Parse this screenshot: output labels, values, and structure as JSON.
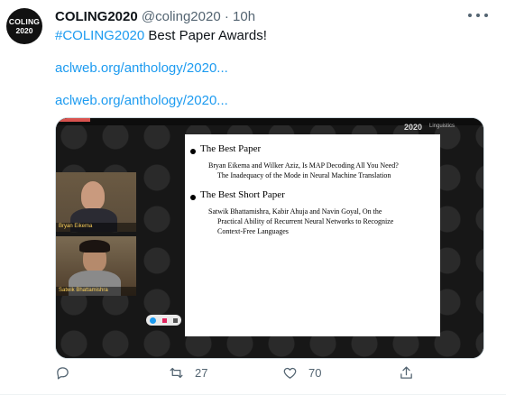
{
  "tweet": {
    "avatar_line1": "COLING",
    "avatar_line2": "2020",
    "author_name": "COLING2020",
    "handle": "@coling2020",
    "separator": "·",
    "time": "10h",
    "text_hashtag": "#COLING2020",
    "text_body": " Best Paper Awards!",
    "link1": "aclweb.org/anthology/2020...",
    "link2": "aclweb.org/anthology/2020..."
  },
  "media": {
    "year_label": "2020",
    "brand_label": "Linguistics",
    "slide": {
      "heading1": "The Best Paper",
      "paper1_line1": "Bryan Eikema and Wilker Aziz, Is MAP Decoding All You Need?",
      "paper1_line2": "The Inadequacy of the Mode in Neural Machine Translation",
      "heading2": "The Best Short Paper",
      "paper2_line1": "Satwik Bhattamishra, Kabir Ahuja and Navin Goyal, On the",
      "paper2_line2": "Practical Ability of Recurrent Neural Networks to Recognize",
      "paper2_line3": "Context-Free Languages"
    },
    "cameras": [
      {
        "name": "Bryan Eikema"
      },
      {
        "name": "Satwik Bhattamishra"
      }
    ]
  },
  "actions": {
    "reply_icon": "reply-icon",
    "retweet_icon": "retweet-icon",
    "retweets": "27",
    "like_icon": "heart-icon",
    "likes": "70",
    "share_icon": "share-icon"
  },
  "colors": {
    "link": "#1d9bf0",
    "secondary_text": "#536471"
  }
}
